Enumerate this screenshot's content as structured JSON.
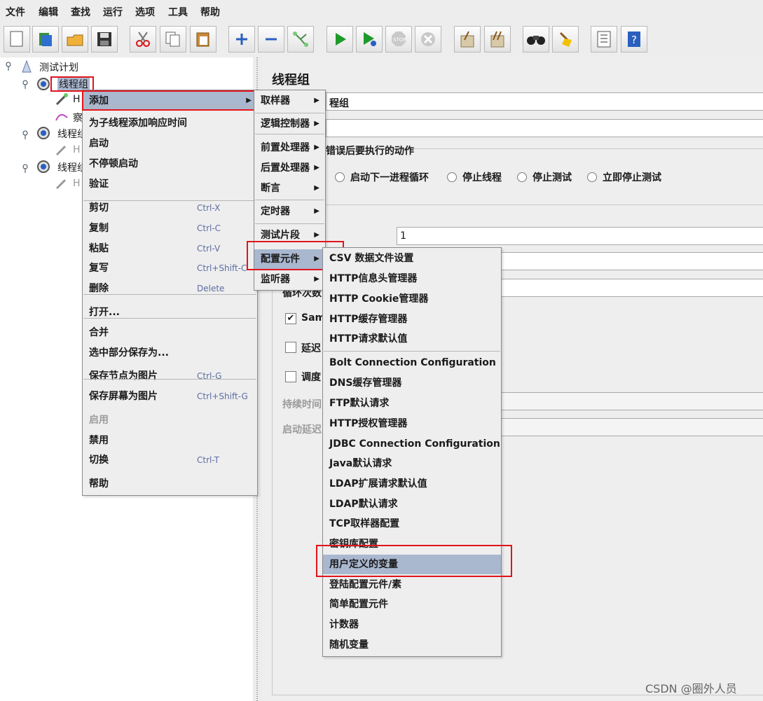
{
  "menubar": [
    "文件",
    "编辑",
    "查找",
    "运行",
    "选项",
    "工具",
    "帮助"
  ],
  "toolbar_icons": [
    "new-icon",
    "templates-icon",
    "open-icon",
    "save-icon",
    "cut-icon",
    "copy-icon",
    "paste-icon",
    "expand-icon",
    "collapse-icon",
    "toggle-icon",
    "start-icon",
    "start-no-pause-icon",
    "stop-icon",
    "shutdown-icon",
    "clear-icon",
    "clear-all-icon",
    "search-icon",
    "reset-search-icon",
    "function-helper-icon",
    "help-icon"
  ],
  "tree": {
    "root": "测试计划",
    "group1": "线程组",
    "child_h": "H",
    "child_view": "察",
    "group2": "线程组",
    "group3": "线程组"
  },
  "panel": {
    "title": "线程组",
    "name_value": "程组",
    "error_action_label": "错误后要执行的动作",
    "radios": [
      "启动下一进程循环",
      "停止线程",
      "停止测试",
      "立即停止测试"
    ],
    "threads_value": "1",
    "loop_label": "循环次数",
    "same_user": "Sam",
    "delay": "延迟",
    "scheduler": "调度",
    "duration": "持续时间",
    "startup_delay": "启动延迟"
  },
  "context_menu": {
    "items": [
      {
        "label": "添加",
        "shortcut": "",
        "arrow": true
      },
      {
        "label": "为子线程添加响应时间",
        "shortcut": ""
      },
      {
        "label": "启动",
        "shortcut": ""
      },
      {
        "label": "不停顿启动",
        "shortcut": ""
      },
      {
        "label": "验证",
        "shortcut": ""
      },
      {
        "label": "剪切",
        "shortcut": "Ctrl-X"
      },
      {
        "label": "复制",
        "shortcut": "Ctrl-C"
      },
      {
        "label": "粘贴",
        "shortcut": "Ctrl-V"
      },
      {
        "label": "复写",
        "shortcut": "Ctrl+Shift-C"
      },
      {
        "label": "删除",
        "shortcut": "Delete"
      },
      {
        "label": "打开...",
        "shortcut": ""
      },
      {
        "label": "合并",
        "shortcut": ""
      },
      {
        "label": "选中部分保存为...",
        "shortcut": ""
      },
      {
        "label": "保存节点为图片",
        "shortcut": "Ctrl-G"
      },
      {
        "label": "保存屏幕为图片",
        "shortcut": "Ctrl+Shift-G"
      },
      {
        "label": "启用",
        "shortcut": ""
      },
      {
        "label": "禁用",
        "shortcut": ""
      },
      {
        "label": "切换",
        "shortcut": "Ctrl-T"
      },
      {
        "label": "帮助",
        "shortcut": ""
      }
    ]
  },
  "add_submenu": [
    "取样器",
    "逻辑控制器",
    "前置处理器",
    "后置处理器",
    "断言",
    "定时器",
    "测试片段",
    "配置元件",
    "监听器"
  ],
  "config_submenu": [
    "CSV 数据文件设置",
    "HTTP信息头管理器",
    "HTTP Cookie管理器",
    "HTTP缓存管理器",
    "HTTP请求默认值",
    "Bolt Connection Configuration",
    "DNS缓存管理器",
    "FTP默认请求",
    "HTTP授权管理器",
    "JDBC Connection Configuration",
    "Java默认请求",
    "LDAP扩展请求默认值",
    "LDAP默认请求",
    "TCP取样器配置",
    "密钥库配置",
    "用户定义的变量",
    "登陆配置元件/素",
    "简单配置元件",
    "计数器",
    "随机变量"
  ],
  "watermark": "CSDN @圈外人员",
  "colors": {
    "highlight": "#a9b7cf",
    "red_box": "#e2141b"
  }
}
